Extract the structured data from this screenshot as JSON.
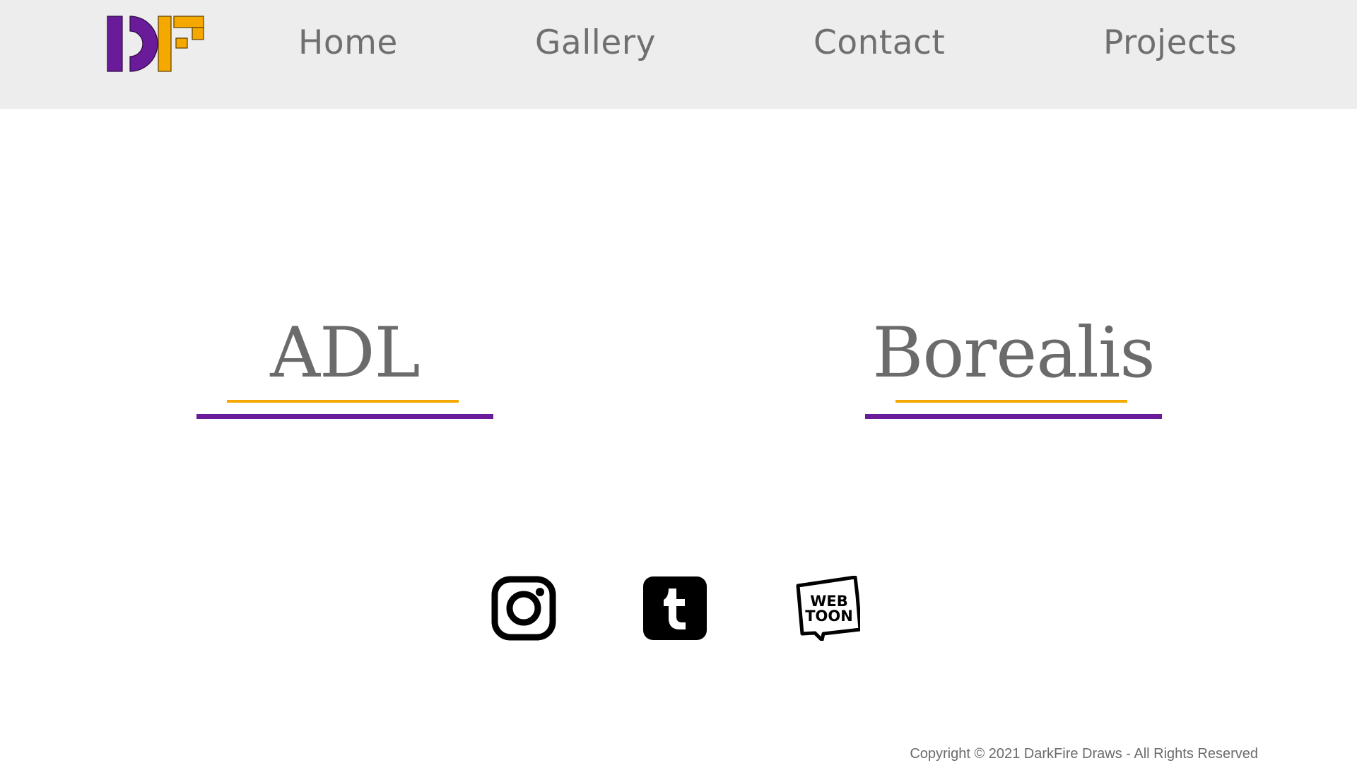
{
  "nav": {
    "logo": "DF",
    "links": [
      "Home",
      "Gallery",
      "Contact",
      "Projects"
    ]
  },
  "projects": [
    {
      "title": "ADL"
    },
    {
      "title": "Borealis"
    }
  ],
  "social": {
    "icons": [
      "instagram-icon",
      "tumblr-icon",
      "webtoon-icon"
    ],
    "webtoon_line1": "WEB",
    "webtoon_line2": "TOON"
  },
  "footer": {
    "copyright": "Copyright © 2021 DarkFire Draws - All Rights Reserved"
  },
  "colors": {
    "nav_bg": "#ededed",
    "text_gray": "#6f6f6f",
    "accent_purple": "#6a1b9a",
    "accent_gold": "#f5a800"
  }
}
